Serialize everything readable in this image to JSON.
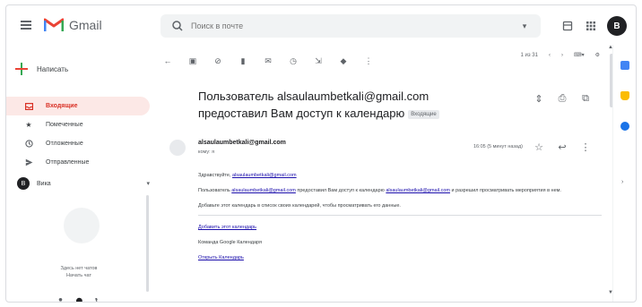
{
  "app": {
    "name": "Gmail"
  },
  "colors": {
    "accent_red": "#d93025",
    "calendar_blue": "#4285f4",
    "keep_yellow": "#fbbc04",
    "tasks_blue": "#1a73e8"
  },
  "search": {
    "placeholder": "Поиск в почте"
  },
  "topbar": {
    "avatar_letter": "B"
  },
  "sidebar": {
    "compose_label": "Написать",
    "items": [
      {
        "label": "Входящие",
        "icon": "inbox-icon",
        "count": ""
      },
      {
        "label": "Помеченные",
        "icon": "star-icon",
        "count": ""
      },
      {
        "label": "Отложенные",
        "icon": "clock-icon",
        "count": ""
      },
      {
        "label": "Отправленные",
        "icon": "send-icon",
        "count": ""
      }
    ],
    "hangouts": {
      "avatar_letter": "B",
      "name": "Вика",
      "empty_text_1": "Здесь нет чатов",
      "empty_text_2": "Начать чат"
    }
  },
  "toolbar": {
    "pager": "1 из 31"
  },
  "message": {
    "subject_line_1": "Пользователь alsaulaumbetkali@gmail.com",
    "subject_line_2": "предоставил Вам доступ к календарю",
    "tag": "Входящие",
    "sender": "alsaulaumbetkali@gmail.com",
    "to": "кому: я",
    "time": "16:05 (5 минут назад)",
    "greeting": "Здравствуйте,",
    "greeting_link": "alsaulaumbetkali@gmail.com",
    "p1_pre": "Пользователь",
    "p1_link": "alsaulaumbetkali@gmail.com",
    "p1_mid": "предоставил Вам доступ к календарю",
    "p1_link2": "alsaulaumbetkali@gmail.com",
    "p1_post": "и разрешил просматривать мероприятия в нем.",
    "p2": "Добавьте этот календарь в список своих календарей, чтобы просматривать его данные.",
    "link_add": "Добавить этот календарь",
    "signature": "Команда Google Календаря",
    "link_more": "Открыть Календарь"
  }
}
